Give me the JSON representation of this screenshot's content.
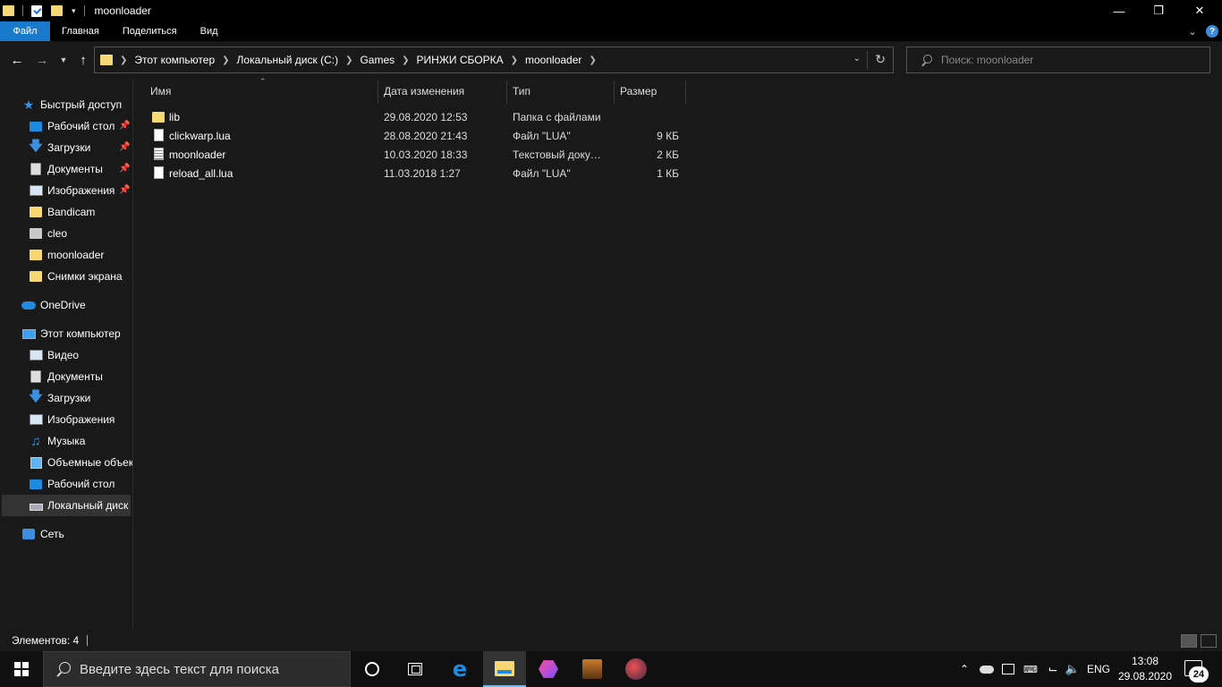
{
  "window": {
    "title": "moonloader",
    "minimize_icon": "minimize-icon",
    "maximize_icon": "maximize-icon",
    "close_icon": "close-icon"
  },
  "ribbon": {
    "tabs": [
      {
        "label": "Файл"
      },
      {
        "label": "Главная"
      },
      {
        "label": "Поделиться"
      },
      {
        "label": "Вид"
      }
    ],
    "accent": "#1979ca"
  },
  "navigation": {
    "breadcrumb": [
      "Этот компьютер",
      "Локальный диск (C:)",
      "Games",
      "РИНЖИ СБОРКА",
      "moonloader"
    ],
    "search_placeholder": "Поиск: moonloader"
  },
  "sidebar": {
    "quick_access": {
      "label": "Быстрый доступ",
      "icon": "star-icon"
    },
    "quick_items": [
      {
        "label": "Рабочий стол",
        "icon": "desktop-icon",
        "pinned": true
      },
      {
        "label": "Загрузки",
        "icon": "download-icon",
        "pinned": true
      },
      {
        "label": "Документы",
        "icon": "document-icon",
        "pinned": true
      },
      {
        "label": "Изображения",
        "icon": "pictures-icon",
        "pinned": true
      },
      {
        "label": "Bandicam",
        "icon": "folder-icon",
        "pinned": false
      },
      {
        "label": "cleo",
        "icon": "folder-icon",
        "pinned": false
      },
      {
        "label": "moonloader",
        "icon": "folder-icon",
        "pinned": false
      },
      {
        "label": "Снимки экрана",
        "icon": "folder-icon",
        "pinned": false
      }
    ],
    "onedrive": {
      "label": "OneDrive",
      "icon": "cloud-icon"
    },
    "this_pc": {
      "label": "Этот компьютер",
      "icon": "computer-icon"
    },
    "pc_items": [
      {
        "label": "Видео",
        "icon": "video-icon"
      },
      {
        "label": "Документы",
        "icon": "document-icon"
      },
      {
        "label": "Загрузки",
        "icon": "download-icon"
      },
      {
        "label": "Изображения",
        "icon": "pictures-icon"
      },
      {
        "label": "Музыка",
        "icon": "music-icon"
      },
      {
        "label": "Объемные объекты",
        "icon": "3d-objects-icon"
      },
      {
        "label": "Рабочий стол",
        "icon": "desktop-icon"
      },
      {
        "label": "Локальный диск (C:)",
        "icon": "drive-icon",
        "selected": true
      }
    ],
    "network": {
      "label": "Сеть",
      "icon": "network-icon"
    }
  },
  "columns": {
    "name": "Имя",
    "date": "Дата изменения",
    "type": "Тип",
    "size": "Размер"
  },
  "files": [
    {
      "name": "lib",
      "date": "29.08.2020 12:53",
      "type": "Папка с файлами",
      "size": "",
      "icon": "folder-icon"
    },
    {
      "name": "clickwarp.lua",
      "date": "28.08.2020 21:43",
      "type": "Файл \"LUA\"",
      "size": "9 КБ",
      "icon": "file-icon"
    },
    {
      "name": "moonloader",
      "date": "10.03.2020 18:33",
      "type": "Текстовый документ",
      "size": "2 КБ",
      "icon": "text-file-icon"
    },
    {
      "name": "reload_all.lua",
      "date": "11.03.2018 1:27",
      "type": "Файл \"LUA\"",
      "size": "1 КБ",
      "icon": "file-icon"
    }
  ],
  "status": {
    "items_count": "Элементов: 4"
  },
  "taskbar": {
    "search_placeholder": "Введите здесь текст для поиска",
    "language": "ENG",
    "time": "13:08",
    "date": "29.08.2020",
    "notifications": "24"
  }
}
